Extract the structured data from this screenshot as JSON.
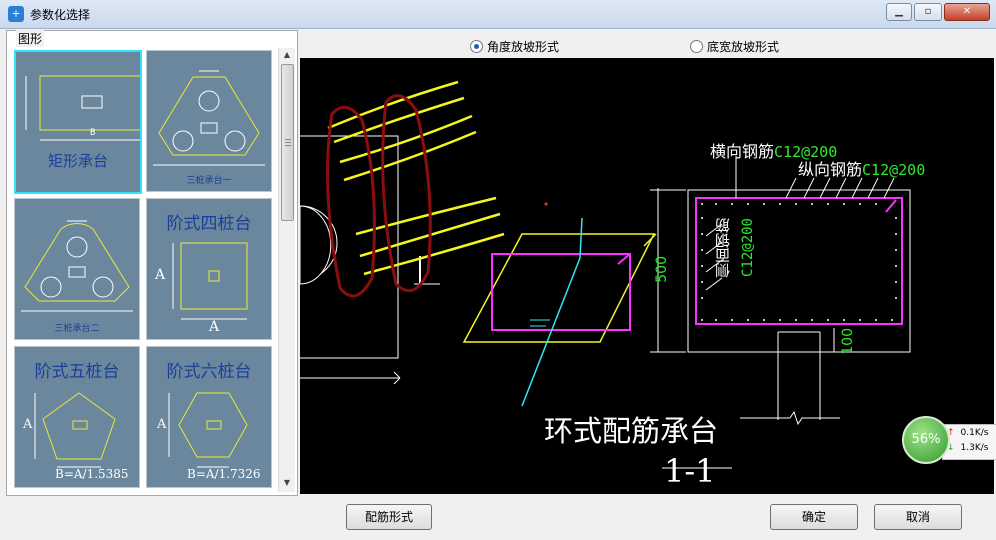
{
  "window": {
    "title": "参数化选择",
    "app_icon": "app-icon",
    "min_icon": "minimize-icon",
    "restore_icon": "restore-icon",
    "close_icon": "close-icon"
  },
  "left_panel": {
    "label": "图形",
    "thumbnails": [
      {
        "name": "矩形承台",
        "selected": true,
        "dim": "B"
      },
      {
        "name": "三桩承台一",
        "selected": false
      },
      {
        "name": "三桩承台二",
        "selected": false
      },
      {
        "name": "阶式四桩台",
        "selected": false,
        "dim": "A",
        "formula": ""
      },
      {
        "name": "阶式五桩台",
        "selected": false,
        "dim": "A",
        "formula": "B=A/1.5385"
      },
      {
        "name": "阶式六桩台",
        "selected": false,
        "dim": "A",
        "formula": "B=A/1.7326"
      }
    ]
  },
  "options": {
    "radio1": {
      "label": "角度放坡形式",
      "checked": true
    },
    "radio2": {
      "label": "底宽放坡形式",
      "checked": false
    }
  },
  "canvas": {
    "title": "环式配筋承台",
    "section": "1-1",
    "transverse_label": "横向钢筋",
    "transverse_value": "C12@200",
    "longitudinal_label": "纵向钢筋",
    "longitudinal_value": "C12@200",
    "side_label": "侧面钢筋",
    "side_value": "C12@200",
    "dim_500": "500",
    "dim_100": "100"
  },
  "buttons": {
    "rebar": "配筋形式",
    "ok": "确定",
    "cancel": "取消"
  },
  "network": {
    "percent": "56%",
    "up": "0.1K/s",
    "down": "1.3K/s"
  }
}
